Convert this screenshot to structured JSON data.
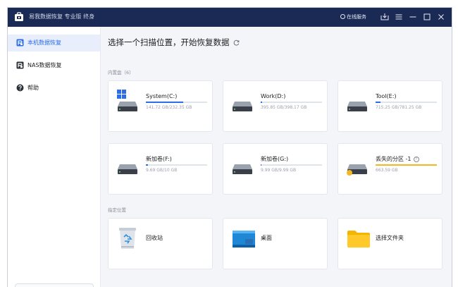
{
  "titlebar": {
    "title": "易我数据恢复 专业版 终身",
    "online_service": "在线服务"
  },
  "sidebar": {
    "items": [
      {
        "label": "本机数据恢复",
        "icon": "local-recovery-icon",
        "active": true
      },
      {
        "label": "NAS数据恢复",
        "icon": "nas-recovery-icon",
        "active": false
      },
      {
        "label": "帮助",
        "icon": "help-icon",
        "active": false
      }
    ]
  },
  "main": {
    "title": "选择一个扫描位置，开始恢复数据",
    "internal_label": "内置盘（6）",
    "specified_label": "指定位置",
    "drives": [
      {
        "name": "System(C:)",
        "size": "141.72 GB/232.35 GB",
        "usage": 0.61,
        "bar_color": "#2d6ee8"
      },
      {
        "name": "Work(D:)",
        "size": "395.85 GB/398.17 GB",
        "usage": 0.02,
        "bar_color": "#2d6ee8"
      },
      {
        "name": "Tool(E:)",
        "size": "715.25 GB/781.25 GB",
        "usage": 0.08,
        "bar_color": "#2d6ee8"
      },
      {
        "name": "新加卷(F:)",
        "size": "9.69 GB/10 GB",
        "usage": 0.03,
        "bar_color": "#2d6ee8"
      },
      {
        "name": "新加卷(G:)",
        "size": "9.99 GB/9.99 GB",
        "usage": 0.01,
        "bar_color": "#2d6ee8"
      },
      {
        "name": "丢失的分区 -1",
        "size": "663.59 GB",
        "usage": 1.0,
        "bar_color": "#f3b820"
      }
    ],
    "locations": [
      {
        "label": "回收站",
        "icon": "recycle-bin-icon"
      },
      {
        "label": "桌面",
        "icon": "desktop-icon"
      },
      {
        "label": "选择文件夹",
        "icon": "folder-icon"
      }
    ]
  },
  "colors": {
    "titlebar": "#1b2a55",
    "accent": "#2d6ee8",
    "lost_partition": "#f3b820"
  }
}
